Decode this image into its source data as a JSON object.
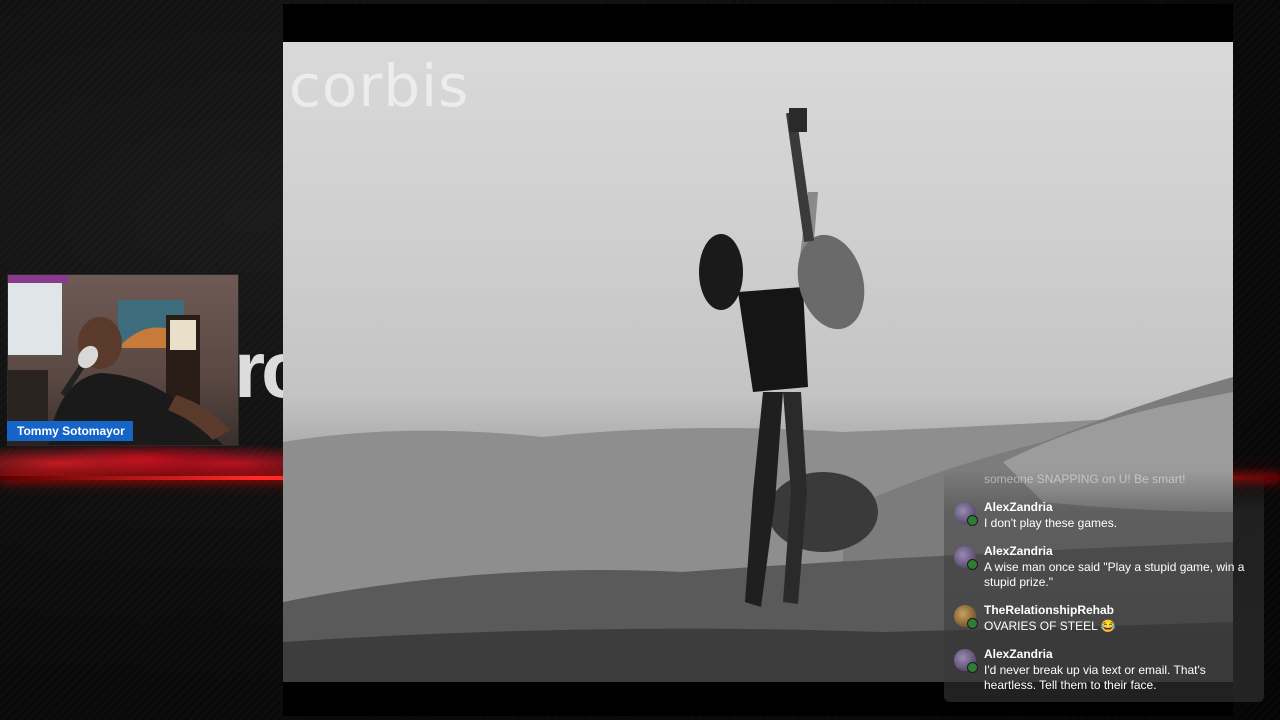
{
  "stream": {
    "brand_partial_text": "rc",
    "video": {
      "watermark": "corbis"
    },
    "webcam": {
      "streamer_name": "Tommy Sotomayor"
    }
  },
  "chat": {
    "faded_message": "someone SNAPPING on U! Be smart!",
    "messages": [
      {
        "user": "AlexZandria",
        "text": "I don't play these games.",
        "avatar": "user-avatar"
      },
      {
        "user": "AlexZandria",
        "text": "A wise man once said \"Play a stupid game, win a stupid prize.\"",
        "avatar": "user-avatar"
      },
      {
        "user": "TheRelationshipRehab",
        "text": "OVARIES OF STEEL 😂",
        "avatar": "user-avatar"
      },
      {
        "user": "AlexZandria",
        "text": "I'd never break up via text or email. That's heartless. Tell them to their face.",
        "avatar": "user-avatar"
      }
    ]
  },
  "colors": {
    "accent_red": "#ff1a1a",
    "name_tag_blue": "#1565c8"
  }
}
